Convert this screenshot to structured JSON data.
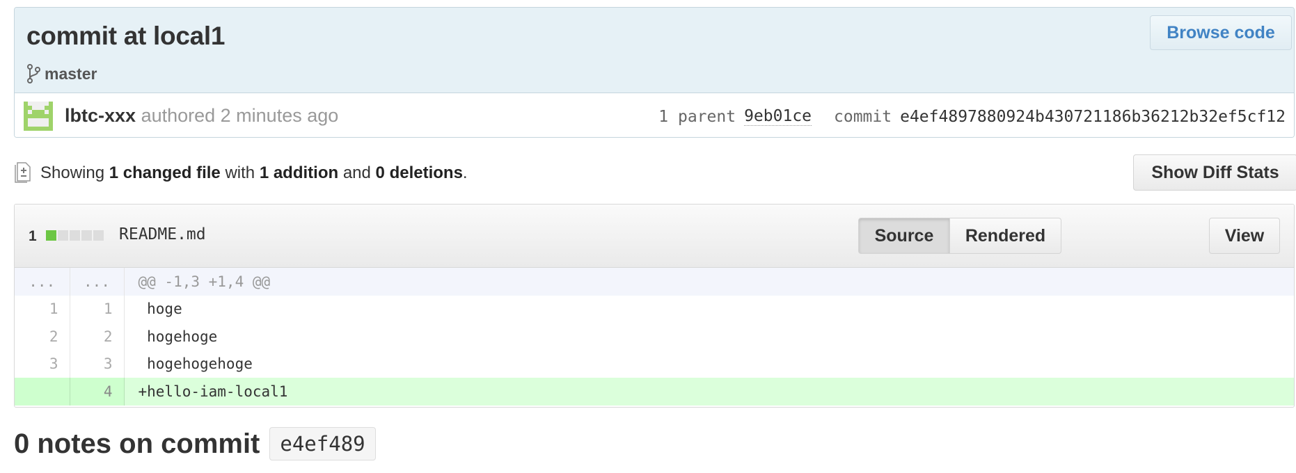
{
  "commit": {
    "title": "commit at local1",
    "branch": "master",
    "browse_label": "Browse code",
    "author": "lbtc-xxx",
    "authored_text": "authored 2 minutes ago",
    "parent_label": "1 parent",
    "parent_sha": "9eb01ce",
    "commit_label": "commit",
    "sha": "e4ef4897880924b430721186b36212b32ef5cf12"
  },
  "summary": {
    "showing": "Showing",
    "changed": "1 changed file",
    "with": "with",
    "additions": "1 addition",
    "and": "and",
    "deletions": "0 deletions",
    "period": ".",
    "diff_stats_button": "Show Diff Stats"
  },
  "file": {
    "count": "1",
    "name": "README.md",
    "source_label": "Source",
    "rendered_label": "Rendered",
    "view_label": "View",
    "selected_mode": "Source",
    "hunk": {
      "old": "...",
      "new": "...",
      "text": "@@ -1,3 +1,4 @@"
    },
    "lines": [
      {
        "old": "1",
        "new": "1",
        "text": " hoge",
        "type": "context"
      },
      {
        "old": "2",
        "new": "2",
        "text": " hogehoge",
        "type": "context"
      },
      {
        "old": "3",
        "new": "3",
        "text": " hogehogehoge",
        "type": "context"
      },
      {
        "old": "",
        "new": "4",
        "text": "+hello-iam-local1",
        "type": "addition"
      }
    ]
  },
  "notes": {
    "title": "0 notes on commit",
    "sha": "e4ef489"
  },
  "colors": {
    "link_blue": "#4183c4",
    "addition_green": "#6cc644",
    "header_bg": "#e6f1f6",
    "addition_bg": "#dbffdb"
  }
}
